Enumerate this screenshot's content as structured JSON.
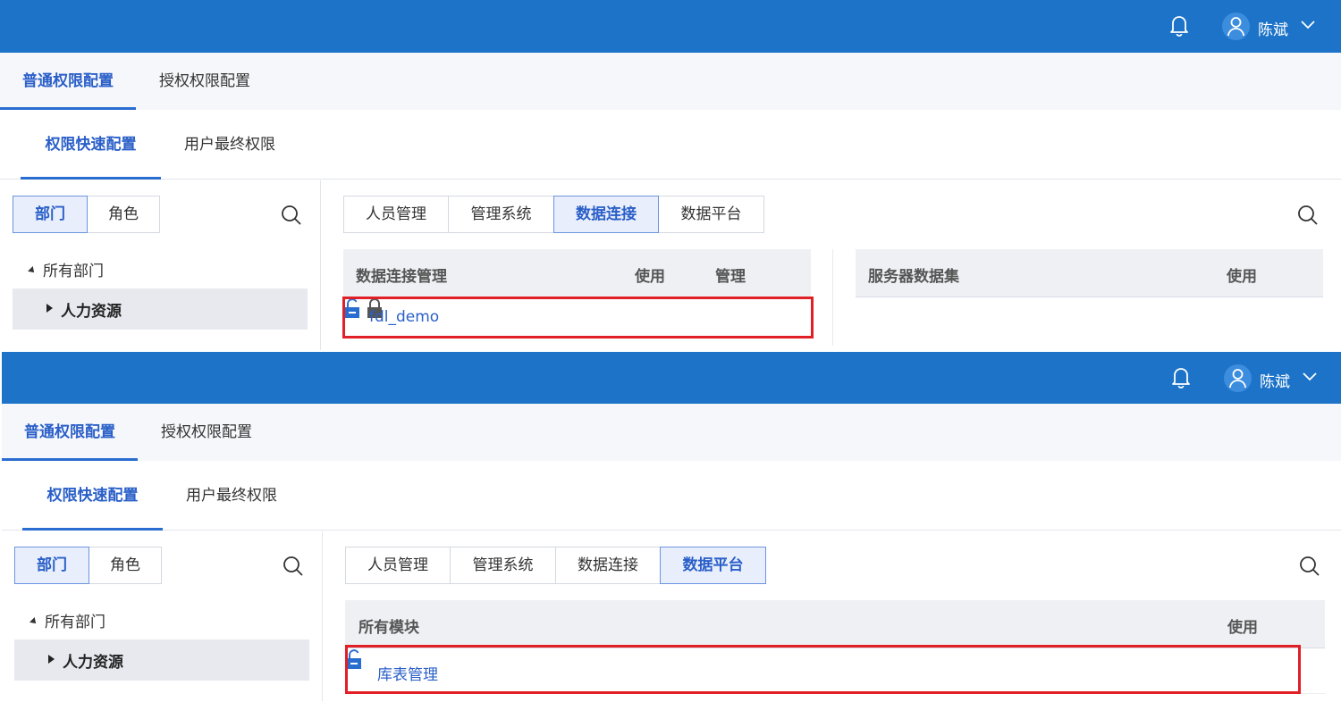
{
  "user": {
    "name": "陈斌"
  },
  "top_tabs": [
    "普通权限配置",
    "授权权限配置"
  ],
  "sub_tabs": [
    "权限快速配置",
    "用户最终权限"
  ],
  "left_toggle": [
    "部门",
    "角色"
  ],
  "tree": {
    "root": "所有部门",
    "selected": "人力资源"
  },
  "module_tabs": [
    "人员管理",
    "管理系统",
    "数据连接",
    "数据平台"
  ],
  "panel1": {
    "active_module": "数据连接",
    "conn_table": {
      "headers": [
        "数据连接管理",
        "使用",
        "管理"
      ],
      "rows": [
        {
          "name": "fdl_demo",
          "use": "unlocked",
          "manage": "locked"
        }
      ]
    },
    "server_table": {
      "headers": [
        "服务器数据集",
        "使用"
      ]
    }
  },
  "panel2": {
    "active_module": "数据平台",
    "module_table": {
      "headers": [
        "所有模块",
        "使用"
      ],
      "rows": [
        {
          "name": "库表管理",
          "use": "unlocked"
        }
      ]
    }
  },
  "colors": {
    "header": "#1c73c8",
    "accent": "#2a5fc8",
    "highlight": "#e11f26"
  },
  "icons": [
    "bell-icon",
    "user-avatar-icon",
    "chevron-down-icon",
    "search-icon",
    "unlock-icon",
    "lock-icon"
  ]
}
